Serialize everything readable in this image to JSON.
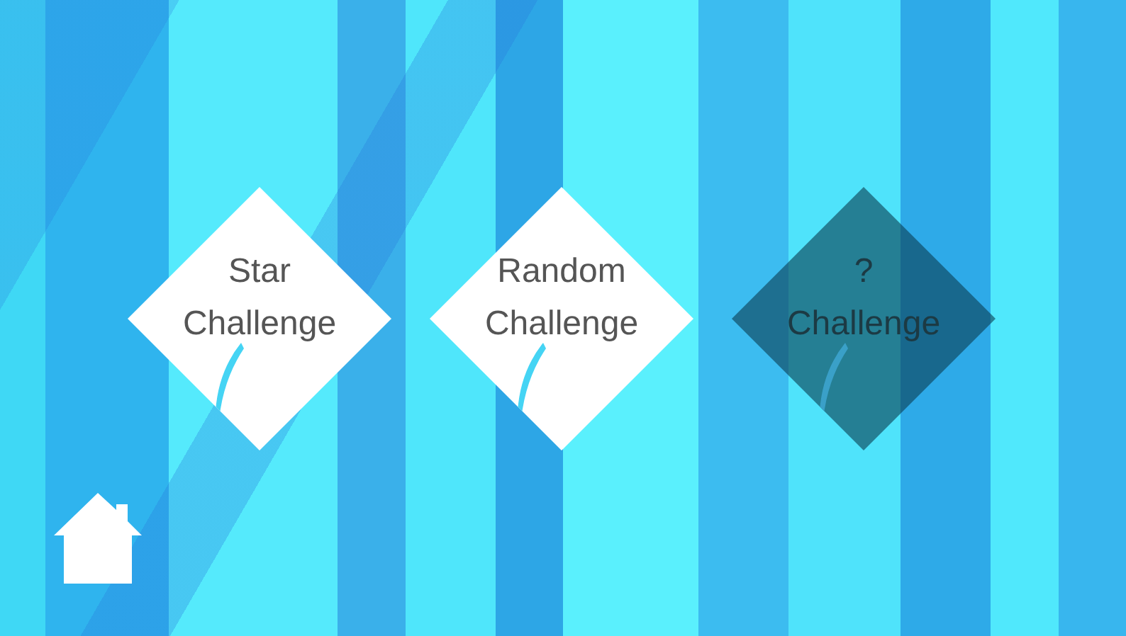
{
  "challenges": [
    {
      "label": "Star Challenge",
      "locked": false
    },
    {
      "label": "Random Challenge",
      "locked": false
    },
    {
      "label": "? Challenge",
      "locked": true
    }
  ]
}
